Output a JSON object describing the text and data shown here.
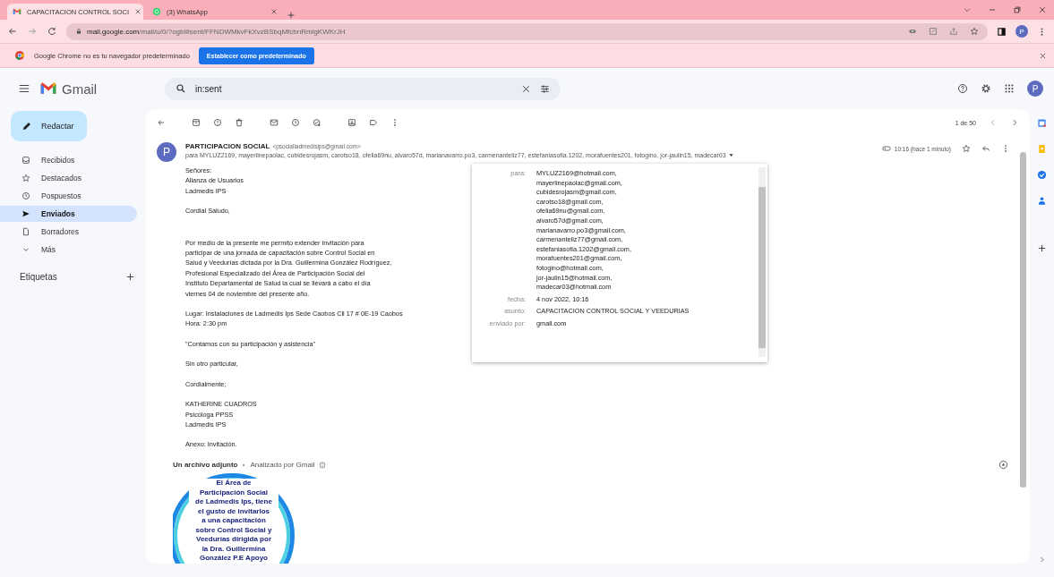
{
  "browser": {
    "tabs": [
      {
        "title": "CAPACITACION CONTROL SOCI",
        "selected": true
      },
      {
        "title": "(3) WhatsApp",
        "selected": false
      }
    ],
    "address": {
      "host": "mail.google.com",
      "path": "/mail/u/0/?ogbl#sent/FFNDWMkvFkXvzBSbqMfcbnRmlgKWKrJH"
    },
    "profile_initial": "P",
    "infobar": {
      "message": "Google Chrome no es tu navegador predeterminado",
      "button": "Establecer como predeterminado"
    }
  },
  "gmail": {
    "logo": "Gmail",
    "search": {
      "value": "in:sent"
    },
    "avatar": "P",
    "compose": "Redactar",
    "nav": [
      {
        "label": "Recibidos",
        "selected": false
      },
      {
        "label": "Destacados",
        "selected": false
      },
      {
        "label": "Pospuestos",
        "selected": false
      },
      {
        "label": "Enviados",
        "selected": true
      },
      {
        "label": "Borradores",
        "selected": false
      },
      {
        "label": "Más",
        "selected": false
      }
    ],
    "labels_heading": "Etiquetas"
  },
  "message": {
    "counter": "1 de 50",
    "avatar": "P",
    "sender_name": "PARTICIPACION SOCIAL",
    "sender_email": "<psocialladmedisips@gmail.com>",
    "recipients": "para MYLUZ2169, mayerlinepaolac, cubidesrojasm, carotso18, ofelia69nu, alvaro57d, marianavarro.po3, carmenanteliz77, estefaniasofia.1202, morafuentes201, fotogino, jor-jaulin15, madecar03",
    "time": "10:16 (hace 1 minuto)",
    "body": [
      [
        "Señores:",
        "Alianza de Usuarios",
        "Ladmedis IPS"
      ],
      [
        "Cordial Saludo,"
      ],
      [
        "Por medio de la presente me permito extender invitación para",
        "participar de una jornada de capacitación sobre Control Social en",
        "Salud y Veedurías dictada por la Dra. Guillermina González Rodríguez,",
        "Profesional Especializado del Área de Participación Social del",
        "Instituto Departamental de Salud la cual se llevará a cabo el día",
        "viernes  04 de noviembre del presente año."
      ],
      [
        "Lugar: Instalaciones de Ladmedis Ips Sede Caobos Cll 17 # 0E-19 Caobos",
        "Hora: 2:30 pm"
      ],
      [
        "\"Contamos con su participación y asistencia\""
      ],
      [
        "Sin otro particular,"
      ],
      [
        " Cordialmente;"
      ],
      [
        "KATHERINE CUADROS",
        "Psicóloga PPSS",
        "Ladmedis IPS"
      ],
      [
        "Anexo: Invitación."
      ]
    ],
    "details": [
      {
        "label": "para:",
        "values": [
          "MYLUZ2169@hotmail.com,",
          "mayerlinepaolac@gmail.com,",
          "cubidesrojasm@gmail.com,",
          "carotso18@gmail.com,",
          "ofelia69nu@gmail.com,",
          "alvaro57d@gmail.com,",
          "marianavarro.po3@gmail.com,",
          "carmenanteliz77@gmail.com,",
          "estefaniasofia.1202@gmail.com,",
          "morafuentes201@gmail.com,",
          "fotogino@hotmail.com,",
          "jor-jaulin15@hotmail.com,",
          "madecar03@hotmail.com"
        ]
      },
      {
        "label": "fecha:",
        "values": [
          "4 nov 2022, 10:16"
        ]
      },
      {
        "label": "asunto:",
        "values": [
          "CAPACITACION CONTROL SOCIAL Y VEEDURIAS"
        ]
      },
      {
        "label": "enviado por:",
        "values": [
          "gmail.com"
        ]
      }
    ],
    "attachment": {
      "heading": "Un archivo adjunto",
      "note": "Analizado por Gmail",
      "preview_lines": [
        "El Área de",
        "Participación Social",
        "de Ladmedis Ips, tiene",
        "el gusto de invitarlos",
        "a una capacitación",
        "sobre Control Social y",
        "Veedurías dirigida por",
        "la Dra. Guillermina",
        "González P.E Apoyo"
      ]
    }
  }
}
